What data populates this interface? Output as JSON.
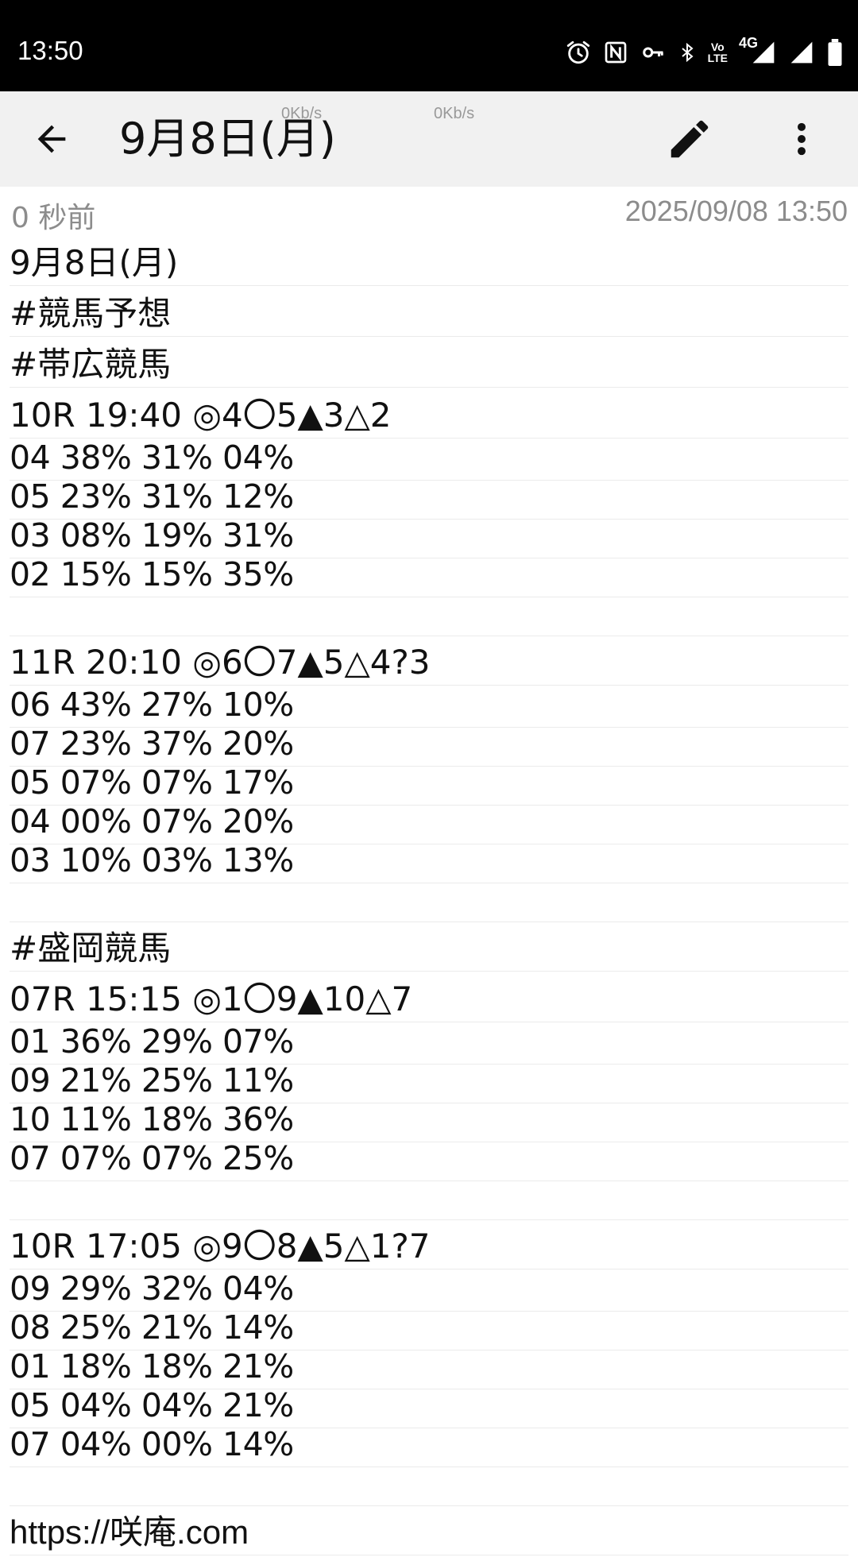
{
  "status_bar": {
    "time": "13:50",
    "icons": [
      "alarm-icon",
      "nfc-icon",
      "vpn-key-icon",
      "bluetooth-icon",
      "volte-icon",
      "signal-4g-icon",
      "signal-icon",
      "battery-icon"
    ],
    "volte_text": [
      "Vo",
      "LTE"
    ],
    "network_label": "4G"
  },
  "app_bar": {
    "title": "9月8日(月)",
    "speed_left": "0Kb/s",
    "speed_right": "0Kb/s",
    "icons": [
      "back-arrow-icon",
      "pencil-icon",
      "more-vert-icon"
    ]
  },
  "meta": {
    "relative_time": "0 秒前",
    "datetime": "2025/09/08 13:50"
  },
  "note": {
    "lines": [
      "9月8日(月)",
      "#競馬予想",
      "#帯広競馬",
      "10R 19:40 ◎4〇5▲3△2",
      "04 38% 31% 04%",
      "05 23% 31% 12%",
      "03 08% 19% 31%",
      "02 15% 15% 35%",
      "",
      "11R 20:10 ◎6〇7▲5△4?3",
      "06 43% 27% 10%",
      "07 23% 37% 20%",
      "05 07% 07% 17%",
      "04 00% 07% 20%",
      "03 10% 03% 13%",
      "",
      "#盛岡競馬",
      "07R 15:15 ◎1〇9▲10△7",
      "01 36% 29% 07%",
      "09 21% 25% 11%",
      "10 11% 18% 36%",
      "07 07% 07% 25%",
      "",
      "10R 17:05 ◎9〇8▲5△1?7",
      "09 29% 32% 04%",
      "08 25% 21% 14%",
      "01 18% 18% 21%",
      "05 04% 04% 21%",
      "07 04% 00% 14%",
      "",
      "https://咲庵.com"
    ]
  }
}
